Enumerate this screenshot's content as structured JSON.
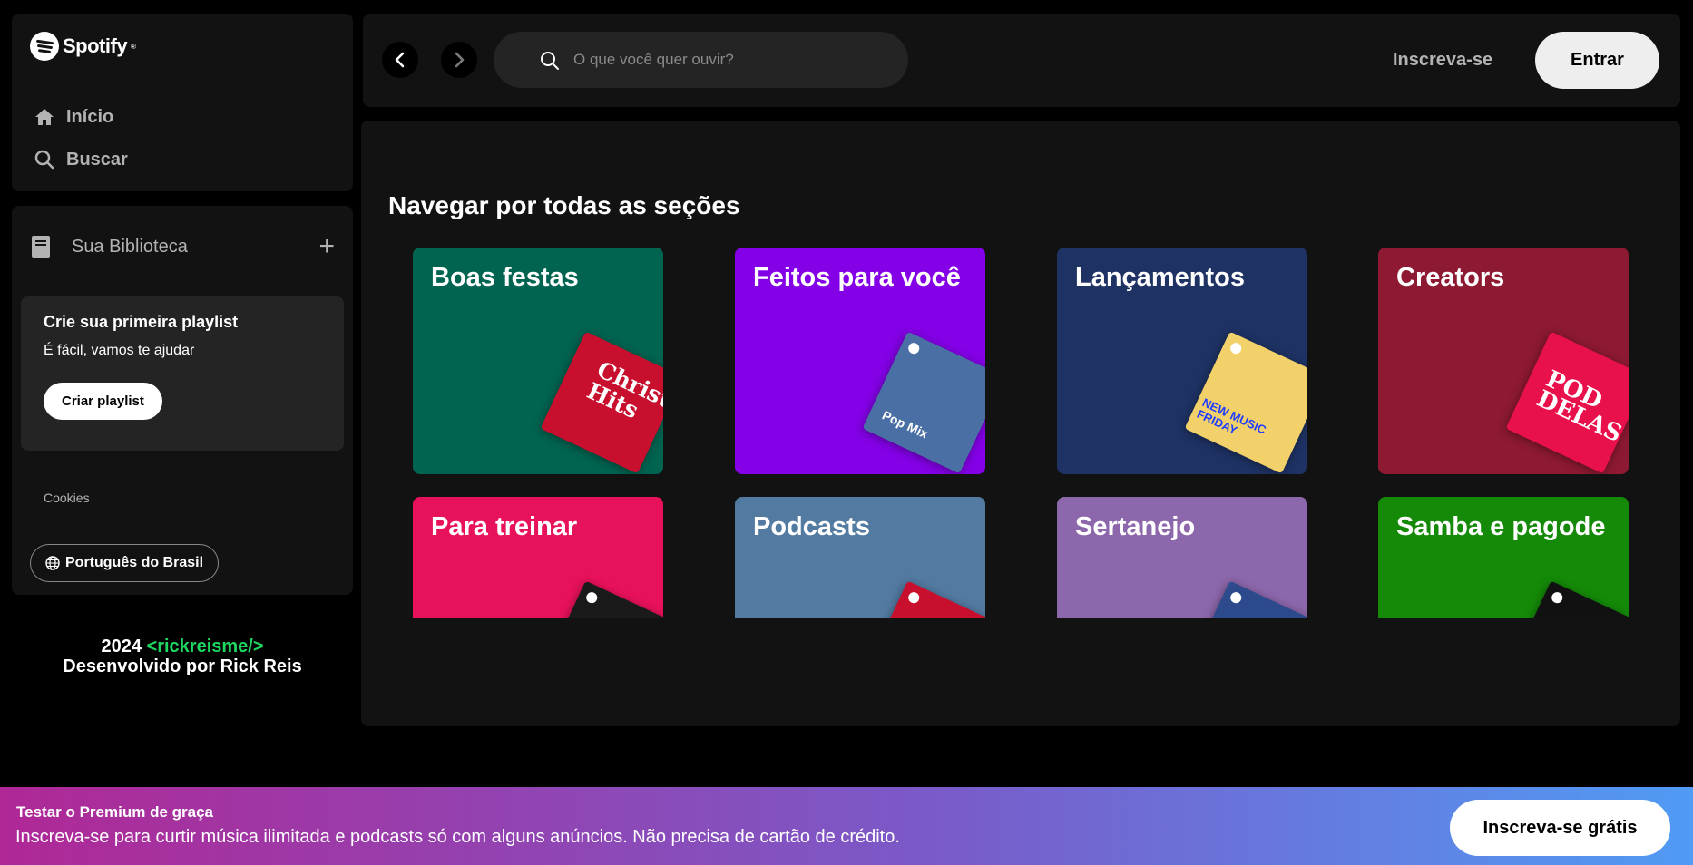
{
  "brand": {
    "name": "Spotify",
    "reg": "®"
  },
  "nav": {
    "home_label": "Início",
    "search_label": "Buscar"
  },
  "library": {
    "title": "Sua Biblioteca",
    "add_symbol": "+",
    "create_card": {
      "heading": "Crie sua primeira playlist",
      "text": "É fácil, vamos te ajudar",
      "button": "Criar playlist"
    },
    "cookies": "Cookies",
    "language": "Português do Brasil"
  },
  "credits": {
    "year": "2024",
    "tag": "<rickreisme/>",
    "line2": "Desenvolvido por Rick Reis"
  },
  "topbar": {
    "search_placeholder": "O que você quer ouvir?",
    "signup": "Inscreva-se",
    "login": "Entrar"
  },
  "browse": {
    "title": "Navegar por todas as seções",
    "cards": [
      {
        "title": "Boas festas",
        "color": "#006450",
        "art_label": "Christmas Hits",
        "art_color": "#c8102e"
      },
      {
        "title": "Feitos para você",
        "color": "#8400e7",
        "art_label": "Pop Mix",
        "art_color": "#4a6fa5"
      },
      {
        "title": "Lançamentos",
        "color": "#1e3264",
        "art_label": "NEW MUSIC FRIDAY",
        "art_color": "#f2d16b"
      },
      {
        "title": "Creators",
        "color": "#8d1932",
        "art_label": "POD DELAS",
        "art_color": "#e8114b"
      },
      {
        "title": "Para treinar",
        "color": "#e8115b",
        "art_label": "",
        "art_color": "#1a1a1a"
      },
      {
        "title": "Podcasts",
        "color": "#537aa1",
        "art_label": "",
        "art_color": "#c8102e"
      },
      {
        "title": "Sertanejo",
        "color": "#8c67ab",
        "art_label": "",
        "art_color": "#2c4a8c"
      },
      {
        "title": "Samba e pagode",
        "color": "#148a08",
        "art_label": "",
        "art_color": "#111111"
      }
    ]
  },
  "banner": {
    "title": "Testar o Premium de graça",
    "text": "Inscreva-se para curtir música ilimitada e podcasts só com alguns anúncios. Não precisa de cartão de crédito.",
    "button": "Inscreva-se grátis"
  }
}
